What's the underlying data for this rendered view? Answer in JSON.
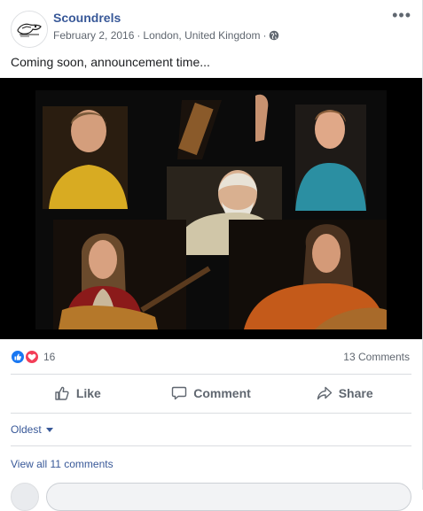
{
  "post": {
    "page_name": "Scoundrels",
    "date": "February 2, 2016",
    "sep1": "·",
    "location": "London, United Kingdom",
    "sep2": "·",
    "text": "Coming soon, announcement time..."
  },
  "reactions": {
    "count": "16",
    "comments": "13 Comments",
    "icons": [
      "like-icon",
      "love-icon"
    ],
    "like_color": "#1877f2",
    "love_color": "#f33e58"
  },
  "actions": {
    "like": "Like",
    "comment": "Comment",
    "share": "Share"
  },
  "comments": {
    "order": "Oldest",
    "view_all": "View all 11 comments"
  },
  "colors": {
    "link": "#385898",
    "muted": "#606770"
  }
}
